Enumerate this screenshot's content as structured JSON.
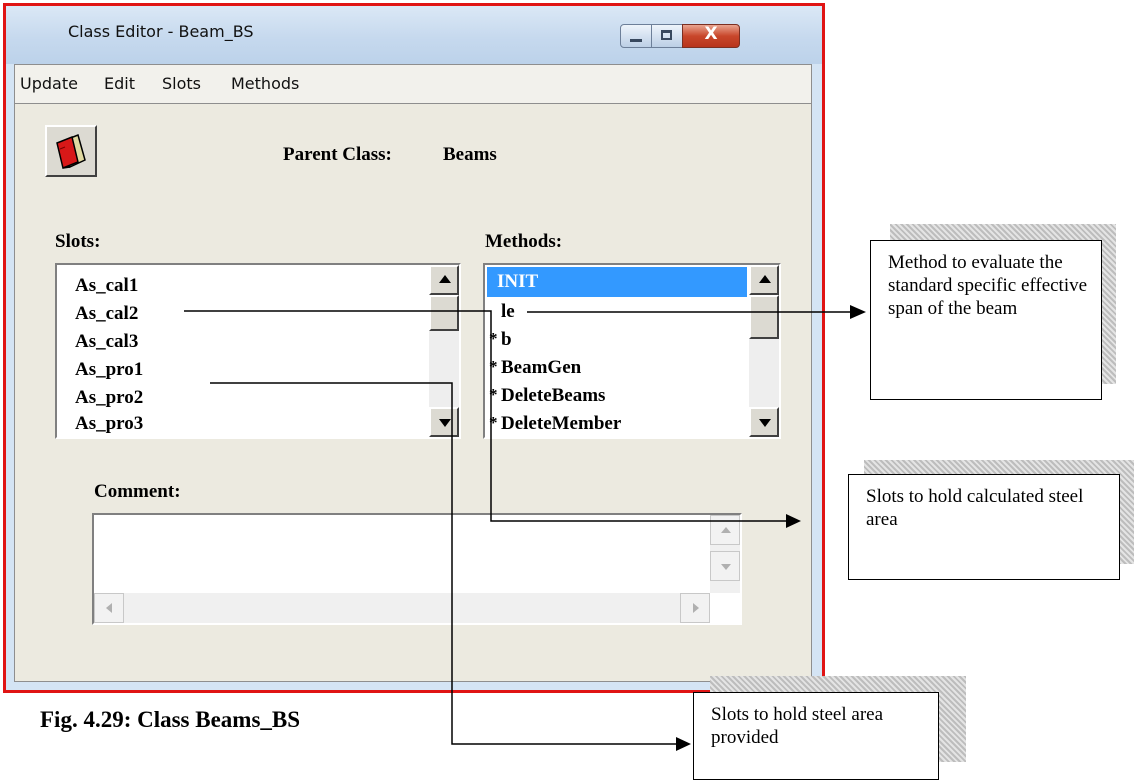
{
  "window": {
    "title": "Class Editor - Beam_BS",
    "close_glyph": "X",
    "menu": [
      "Update",
      "Edit",
      "Slots",
      "Methods"
    ]
  },
  "header": {
    "parent_label": "Parent Class:",
    "parent_value": "Beams"
  },
  "slots": {
    "heading": "Slots:",
    "items": [
      "As_cal1",
      "As_cal2",
      "As_cal3",
      "As_pro1",
      "As_pro2",
      "As_pro3"
    ]
  },
  "methods": {
    "heading": "Methods:",
    "items": [
      {
        "label": "INIT",
        "star": "",
        "selected": true
      },
      {
        "label": "le",
        "star": "",
        "selected": false
      },
      {
        "label": "b",
        "star": "*",
        "selected": false
      },
      {
        "label": "BeamGen",
        "star": "*",
        "selected": false
      },
      {
        "label": "DeleteBeams",
        "star": "*",
        "selected": false
      },
      {
        "label": "DeleteMember",
        "star": "*",
        "selected": false
      }
    ]
  },
  "comment": {
    "heading": "Comment:",
    "value": ""
  },
  "caption": "Fig. 4.29: Class Beams_BS",
  "callouts": {
    "method": "Method to evaluate the standard specific effective span of the beam",
    "calculated": "Slots to hold calculated steel area",
    "provided": "Slots to hold steel area provided"
  },
  "colors": {
    "window_border": "#e01414",
    "selection": "#3399ff",
    "close_button": "#c8472b"
  },
  "icons": [
    "book-icon",
    "minimize-icon",
    "maximize-icon",
    "close-icon",
    "scroll-up-icon",
    "scroll-down-icon",
    "scroll-left-icon",
    "scroll-right-icon"
  ]
}
